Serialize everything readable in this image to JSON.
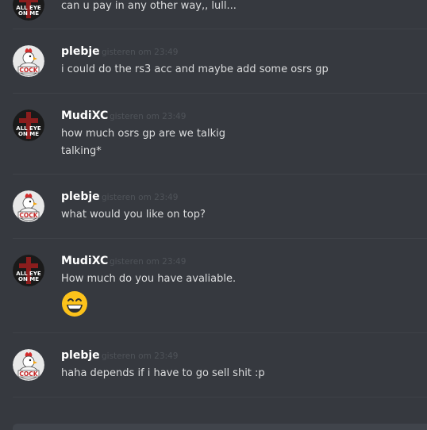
{
  "messages": [
    {
      "lines": [
        "can u pay in any other way,, lull..."
      ]
    },
    {
      "author": "plebje",
      "time": "gisteren om 23:49",
      "avatar": "chicken-icon",
      "lines": [
        "i could do the rs3 acc and maybe add some osrs gp"
      ]
    },
    {
      "author": "MudiXC",
      "time": "gisteren om 23:49",
      "avatar": "cross-logo-icon",
      "lines": [
        "how much osrs gp are we talkig",
        "talking*"
      ]
    },
    {
      "author": "plebje",
      "time": "gisteren om 23:49",
      "avatar": "chicken-icon",
      "lines": [
        "what would you like on top?"
      ]
    },
    {
      "author": "MudiXC",
      "time": "gisteren om 23:49",
      "avatar": "cross-logo-icon",
      "lines": [
        "How much do you have avaliable."
      ],
      "emoji": "grinning-face-icon"
    },
    {
      "author": "plebje",
      "time": "gisteren om 23:49",
      "avatar": "chicken-icon",
      "lines": [
        "haha depends if i have to go sell shit :p"
      ]
    }
  ],
  "avatar_text": {
    "chicken": "COCK",
    "cross_top": "ALL EYE",
    "cross_bottom": "ON ME"
  },
  "colors": {
    "background": "#36393f",
    "username": "#ffffff",
    "message_text": "#dcddde",
    "timestamp": "#4f5359",
    "divider": "#3f4248",
    "emoji": "#fcc21b"
  }
}
